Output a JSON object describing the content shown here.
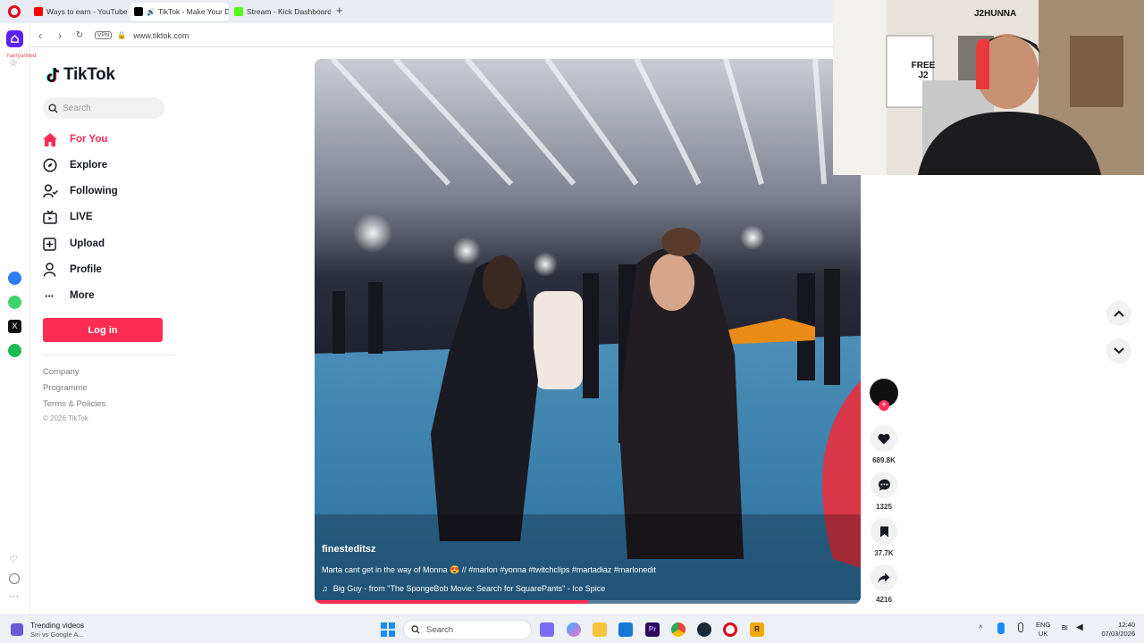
{
  "tabs": [
    {
      "label": "Ways to earn - YouTube S",
      "favicon_color": "#ff0000"
    },
    {
      "label": "TikTok - Make Your Da",
      "favicon_color": "#000000"
    },
    {
      "label": "Stream - Kick Dashboard",
      "favicon_color": "#53fc18"
    }
  ],
  "address": {
    "vpn_label": "VPN",
    "url": "www.tiktok.com"
  },
  "opera": {
    "profile_name": "harryanited"
  },
  "tiktok": {
    "brand": "TikTok",
    "search_placeholder": "Search",
    "nav": [
      {
        "label": "For You",
        "icon": "home-icon",
        "active": true
      },
      {
        "label": "Explore",
        "icon": "compass-icon",
        "active": false
      },
      {
        "label": "Following",
        "icon": "following-icon",
        "active": false
      },
      {
        "label": "LIVE",
        "icon": "live-icon",
        "active": false
      },
      {
        "label": "Upload",
        "icon": "upload-icon",
        "active": false
      },
      {
        "label": "Profile",
        "icon": "profile-icon",
        "active": false
      },
      {
        "label": "More",
        "icon": "more-icon",
        "active": false
      }
    ],
    "login_label": "Log in",
    "footer": [
      "Company",
      "Programme",
      "Terms & Policies",
      "© 2026 TikTok"
    ],
    "accent": "#fe2c55"
  },
  "video": {
    "author": "finesteditsz",
    "caption": "Marta cant get in the way of Monna 😍 // #marlon #yonna #twitchclips #martadiaz #marlonedit",
    "music": "Big Guy - from \"The SpongeBob Movie: Search for SquarePants\" - Ice Spice",
    "progress": 0.5
  },
  "actions": {
    "likes": "689.8K",
    "comments": "1325",
    "saves": "37.7K",
    "shares": "4216"
  },
  "webcam": {
    "poster_text": "FREE J2",
    "wall_text": "J2HUNNA"
  },
  "taskbar": {
    "notification_title": "Trending videos",
    "notification_sub": "Siri vs Google A...",
    "search_placeholder": "Search",
    "lang_top": "ENG",
    "lang_bottom": "UK",
    "time": "12:40",
    "date": "07/03/2026"
  }
}
